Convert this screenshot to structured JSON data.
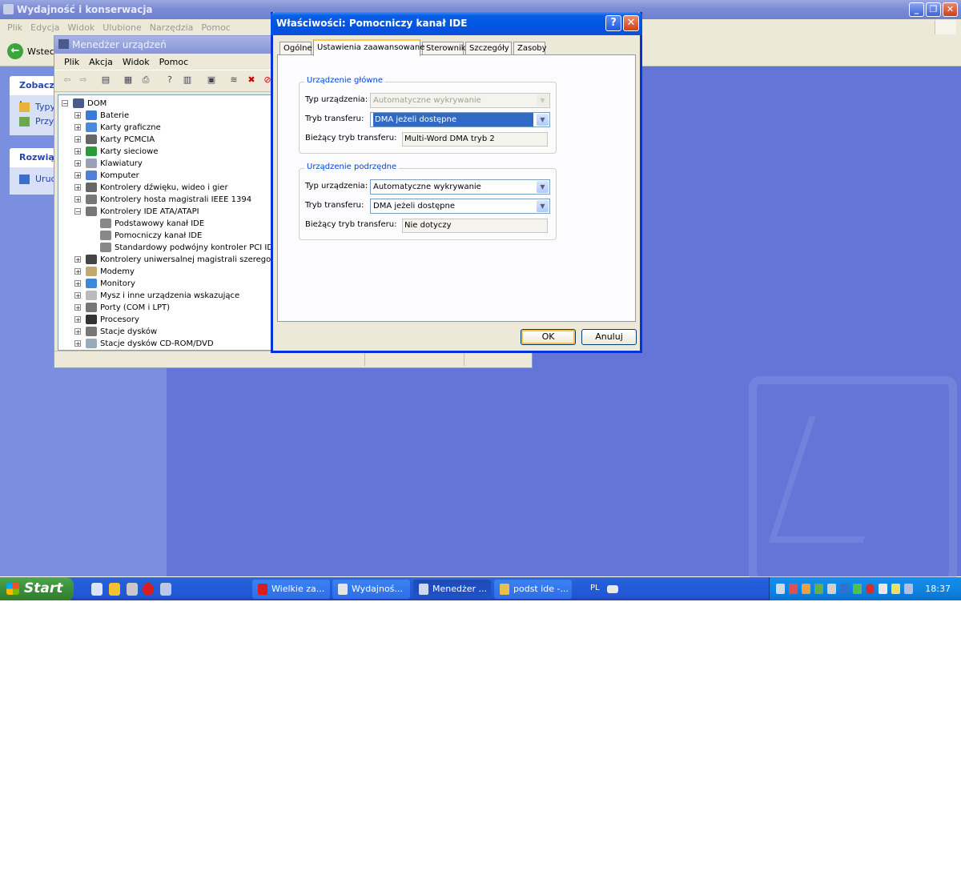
{
  "background_window": {
    "title": "Wydajność i konserwacja",
    "menu": [
      "Plik",
      "Edycja",
      "Widok",
      "Ulubione",
      "Narzędzia",
      "Pomoc"
    ],
    "back_label": "Wstecz",
    "panel_see_also": {
      "header": "Zobacz t",
      "items": [
        "Typy",
        "Przy"
      ]
    },
    "panel_troubleshoot": {
      "header": "Rozwiąż",
      "items": [
        "Uruc"
      ]
    }
  },
  "device_manager": {
    "title": "Menedżer urządzeń",
    "menu": [
      "Plik",
      "Akcja",
      "Widok",
      "Pomoc"
    ],
    "tree": {
      "root": "DOM",
      "items": [
        {
          "label": "Baterie",
          "level": 1,
          "expand": "+"
        },
        {
          "label": "Karty graficzne",
          "level": 1,
          "expand": "+"
        },
        {
          "label": "Karty PCMCIA",
          "level": 1,
          "expand": "+"
        },
        {
          "label": "Karty sieciowe",
          "level": 1,
          "expand": "+"
        },
        {
          "label": "Klawiatury",
          "level": 1,
          "expand": "+"
        },
        {
          "label": "Komputer",
          "level": 1,
          "expand": "+"
        },
        {
          "label": "Kontrolery dźwięku, wideo i gier",
          "level": 1,
          "expand": "+"
        },
        {
          "label": "Kontrolery hosta magistrali IEEE 1394",
          "level": 1,
          "expand": "+"
        },
        {
          "label": "Kontrolery IDE ATA/ATAPI",
          "level": 1,
          "expand": "-"
        },
        {
          "label": "Podstawowy kanał IDE",
          "level": 2,
          "expand": ""
        },
        {
          "label": "Pomocniczy kanał IDE",
          "level": 2,
          "expand": ""
        },
        {
          "label": "Standardowy podwójny kontroler PCI IDE",
          "level": 2,
          "expand": ""
        },
        {
          "label": "Kontrolery uniwersalnej magistrali szeregowej",
          "level": 1,
          "expand": "+"
        },
        {
          "label": "Modemy",
          "level": 1,
          "expand": "+"
        },
        {
          "label": "Monitory",
          "level": 1,
          "expand": "+"
        },
        {
          "label": "Mysz i inne urządzenia wskazujące",
          "level": 1,
          "expand": "+"
        },
        {
          "label": "Porty (COM i LPT)",
          "level": 1,
          "expand": "+"
        },
        {
          "label": "Procesory",
          "level": 1,
          "expand": "+"
        },
        {
          "label": "Stacje dysków",
          "level": 1,
          "expand": "+"
        },
        {
          "label": "Stacje dysków CD-ROM/DVD",
          "level": 1,
          "expand": "+"
        }
      ]
    }
  },
  "dialog": {
    "title": "Właściwości: Pomocniczy kanał IDE",
    "tabs": [
      "Ogólne",
      "Ustawienia zaawansowane",
      "Sterownik",
      "Szczegóły",
      "Zasoby"
    ],
    "active_tab": 1,
    "primary": {
      "group_label": "Urządzenie główne",
      "device_type_label": "Typ urządzenia:",
      "device_type_value": "Automatyczne wykrywanie",
      "transfer_mode_label": "Tryb transferu:",
      "transfer_mode_value": "DMA jeżeli dostępne",
      "current_mode_label": "Bieżący tryb transferu:",
      "current_mode_value": "Multi-Word DMA tryb 2"
    },
    "secondary": {
      "group_label": "Urządzenie podrzędne",
      "device_type_label": "Typ urządzenia:",
      "device_type_value": "Automatyczne wykrywanie",
      "transfer_mode_label": "Tryb transferu:",
      "transfer_mode_value": "DMA jeżeli dostępne",
      "current_mode_label": "Bieżący tryb transferu:",
      "current_mode_value": "Nie dotyczy"
    },
    "ok_label": "OK",
    "cancel_label": "Anuluj"
  },
  "taskbar": {
    "start_label": "Start",
    "buttons": [
      {
        "label": "Wielkie za...",
        "icon": "opera-icon",
        "color": "#d81e1e"
      },
      {
        "label": "Wydajnoś...",
        "icon": "performance-icon",
        "color": "#e5e5e5"
      },
      {
        "label": "Menedżer ...",
        "icon": "device-manager-icon",
        "color": "#d0d8f0"
      },
      {
        "label": "podst ide -...",
        "icon": "paint-icon",
        "color": "#e8c050"
      }
    ],
    "language": "PL",
    "clock": "18:37"
  },
  "colors": {
    "xp_blue_title": "#0054e3",
    "desktop": "#6375d6",
    "selection": "#316ac5",
    "start_green": "#3a8e3a",
    "tray_blue": "#0f84e2"
  }
}
